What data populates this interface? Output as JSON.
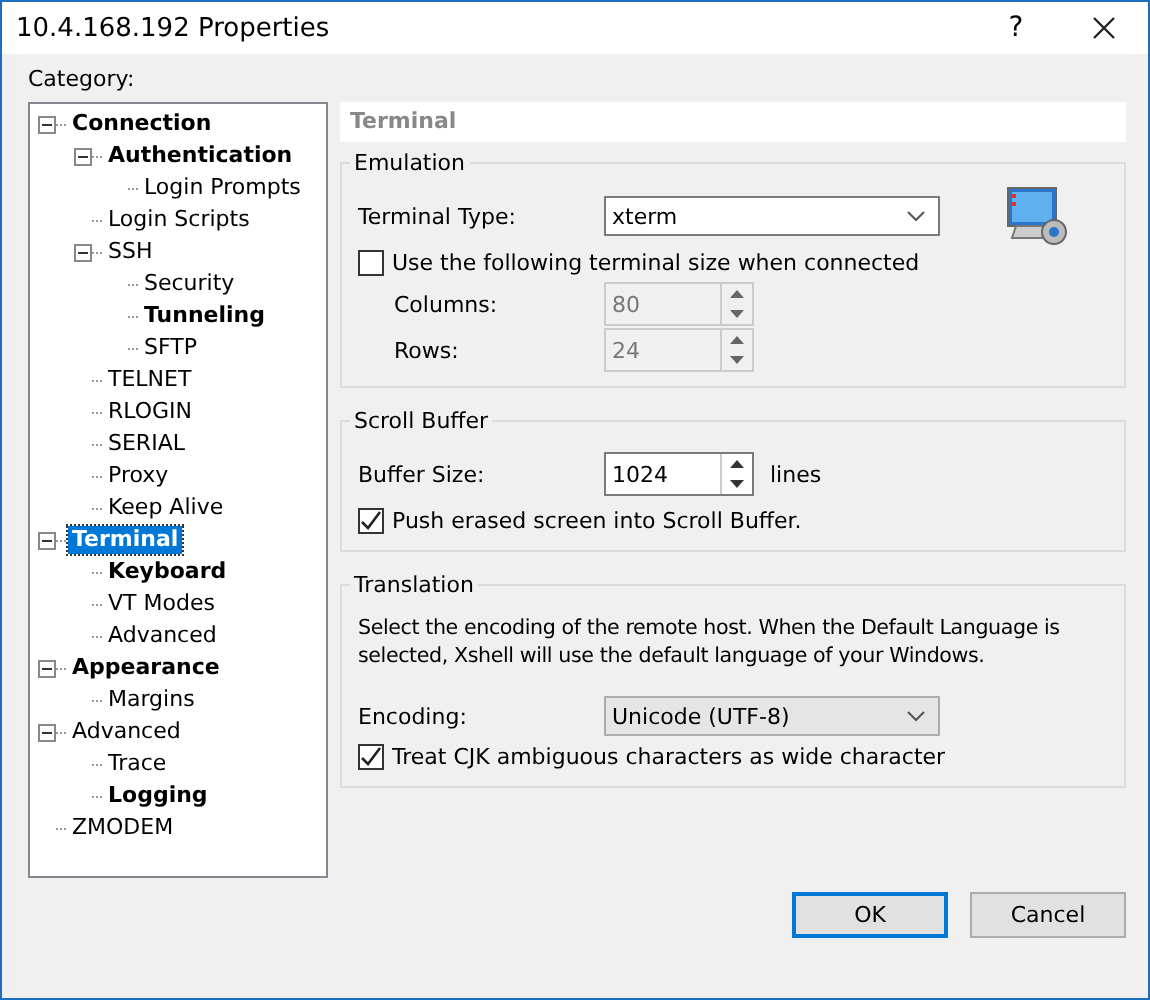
{
  "window": {
    "title": "10.4.168.192 Properties",
    "help": "?"
  },
  "category_label": "Category:",
  "tree": [
    {
      "label": "Connection",
      "bold": true,
      "selected": false,
      "expanded": true,
      "children": [
        {
          "label": "Authentication",
          "bold": true,
          "selected": false,
          "expanded": true,
          "children": [
            {
              "label": "Login Prompts",
              "bold": false,
              "selected": false
            }
          ]
        },
        {
          "label": "Login Scripts",
          "bold": false,
          "selected": false
        },
        {
          "label": "SSH",
          "bold": false,
          "selected": false,
          "expanded": true,
          "children": [
            {
              "label": "Security",
              "bold": false,
              "selected": false
            },
            {
              "label": "Tunneling",
              "bold": true,
              "selected": false
            },
            {
              "label": "SFTP",
              "bold": false,
              "selected": false
            }
          ]
        },
        {
          "label": "TELNET",
          "bold": false,
          "selected": false
        },
        {
          "label": "RLOGIN",
          "bold": false,
          "selected": false
        },
        {
          "label": "SERIAL",
          "bold": false,
          "selected": false
        },
        {
          "label": "Proxy",
          "bold": false,
          "selected": false
        },
        {
          "label": "Keep Alive",
          "bold": false,
          "selected": false
        }
      ]
    },
    {
      "label": "Terminal",
      "bold": true,
      "selected": true,
      "expanded": true,
      "children": [
        {
          "label": "Keyboard",
          "bold": true,
          "selected": false
        },
        {
          "label": "VT Modes",
          "bold": false,
          "selected": false
        },
        {
          "label": "Advanced",
          "bold": false,
          "selected": false
        }
      ]
    },
    {
      "label": "Appearance",
      "bold": true,
      "selected": false,
      "expanded": true,
      "children": [
        {
          "label": "Margins",
          "bold": false,
          "selected": false
        }
      ]
    },
    {
      "label": "Advanced",
      "bold": false,
      "selected": false,
      "expanded": true,
      "children": [
        {
          "label": "Trace",
          "bold": false,
          "selected": false
        },
        {
          "label": "Logging",
          "bold": true,
          "selected": false
        }
      ]
    },
    {
      "label": "ZMODEM",
      "bold": false,
      "selected": false
    }
  ],
  "panel_title": "Terminal",
  "emulation": {
    "title": "Emulation",
    "terminal_type_label": "Terminal Type:",
    "terminal_type": "xterm",
    "size_checkbox": {
      "label": "Use the following terminal size when connected",
      "checked": false
    },
    "columns_label": "Columns:",
    "columns": "80",
    "rows_label": "Rows:",
    "rows": "24"
  },
  "scroll_buffer": {
    "title": "Scroll Buffer",
    "buffer_size_label": "Buffer Size:",
    "buffer_size": "1024",
    "unit": "lines",
    "push_checkbox": {
      "label": "Push erased screen into Scroll Buffer.",
      "checked": true
    }
  },
  "translation": {
    "title": "Translation",
    "description": "Select the encoding of the remote host. When the Default Language is selected, Xshell will use the default language of your Windows.",
    "encoding_label": "Encoding:",
    "encoding": "Unicode (UTF-8)",
    "cjk_checkbox": {
      "label": "Treat CJK ambiguous characters as wide character",
      "checked": true
    }
  },
  "buttons": [
    {
      "label": "OK",
      "default": true
    },
    {
      "label": "Cancel",
      "default": false
    }
  ]
}
